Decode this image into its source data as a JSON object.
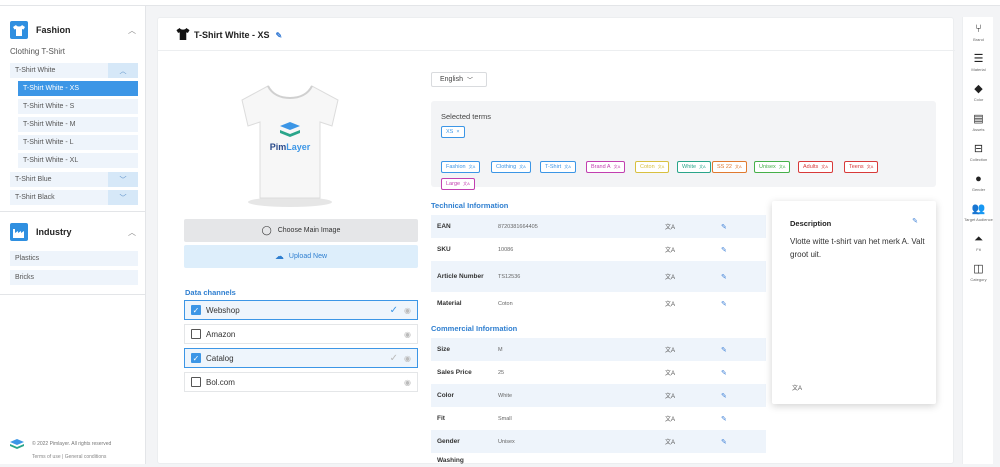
{
  "categories": [
    {
      "label": "Fashion",
      "icon": "tshirt-icon"
    },
    {
      "label": "Industry",
      "icon": "factory-icon"
    }
  ],
  "subcategory_title": "Clothing T-Shirt",
  "nav": {
    "group1": "T-Shirt White",
    "variants": [
      "T-Shirt White - XS",
      "T-Shirt White - S",
      "T-Shirt White - M",
      "T-Shirt White - L",
      "T-Shirt White - XL"
    ],
    "group2": "T-Shirt Blue",
    "group3": "T-Shirt Black"
  },
  "industry_items": [
    "Plastics",
    "Bricks"
  ],
  "footer": {
    "copyright": "© 2022 Pimlayer. All rights reserved",
    "links": "Terms of use  |  General conditions"
  },
  "product": {
    "title": "T-Shirt White - XS"
  },
  "image": {
    "brand_text": "PimLayer",
    "brand_prefix": "Pim",
    "brand_suffix": "Layer"
  },
  "buttons": {
    "choose_image": "Choose Main Image",
    "upload_new": "Upload New"
  },
  "data_channels": {
    "title": "Data channels",
    "items": [
      {
        "label": "Webshop",
        "checked": true
      },
      {
        "label": "Amazon",
        "checked": false
      },
      {
        "label": "Catalog",
        "checked": true
      },
      {
        "label": "Bol.com",
        "checked": false
      }
    ]
  },
  "language": {
    "selected": "English"
  },
  "terms": {
    "title": "Selected terms",
    "selected": "XS",
    "tags": [
      {
        "label": "Fashion",
        "color": "#3c96e6"
      },
      {
        "label": "Clothing",
        "color": "#3c96e6"
      },
      {
        "label": "T-Shirt",
        "color": "#3c96e6"
      },
      {
        "label": "Brand A",
        "color": "#c23fb0"
      },
      {
        "label": "Coton",
        "color": "#d8c040"
      },
      {
        "label": "White",
        "color": "#2aa58a"
      },
      {
        "label": "SS 22",
        "color": "#e07a30"
      },
      {
        "label": "Unisex",
        "color": "#46b04a"
      },
      {
        "label": "Adults",
        "color": "#d83a3a"
      },
      {
        "label": "Teens",
        "color": "#d83a3a"
      },
      {
        "label": "Large",
        "color": "#c23fb0"
      }
    ]
  },
  "technical": {
    "title": "Technical Information",
    "rows": [
      {
        "key": "EAN",
        "value": "8720381664405"
      },
      {
        "key": "SKU",
        "value": "10086"
      },
      {
        "key": "Article Number",
        "value": "TS12536"
      },
      {
        "key": "Material",
        "value": "Coton"
      }
    ]
  },
  "commercial": {
    "title": "Commercial Information",
    "rows": [
      {
        "key": "Size",
        "value": "M"
      },
      {
        "key": "Sales Price",
        "value": "25"
      },
      {
        "key": "Color",
        "value": "White"
      },
      {
        "key": "Fit",
        "value": "Small"
      },
      {
        "key": "Gender",
        "value": "Unisex"
      },
      {
        "key": "Washing",
        "value": ""
      }
    ]
  },
  "description": {
    "title": "Description",
    "text": "Vlotte witte t-shirt van het merk A. Valt groot uit."
  },
  "rightbar": [
    {
      "label": "Brand",
      "icon": "branch-icon"
    },
    {
      "label": "Material",
      "icon": "list-icon"
    },
    {
      "label": "Color",
      "icon": "paint-bucket-icon"
    },
    {
      "label": "Assets",
      "icon": "document-icon"
    },
    {
      "label": "Collection",
      "icon": "collection-icon"
    },
    {
      "label": "Gender",
      "icon": "gender-icon"
    },
    {
      "label": "Target Audience",
      "icon": "people-icon"
    },
    {
      "label": "Fit",
      "icon": "hanger-icon"
    },
    {
      "label": "Category",
      "icon": "category-icon"
    }
  ]
}
